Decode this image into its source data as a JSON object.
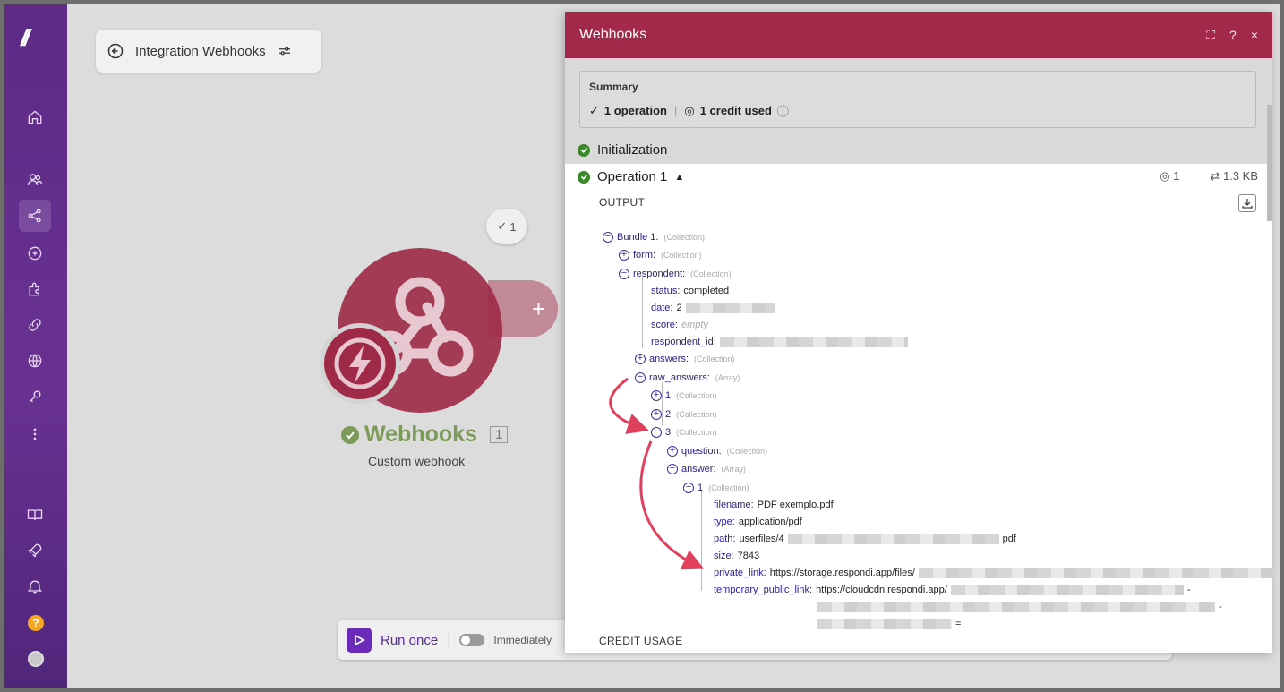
{
  "breadcrumb": {
    "title": "Integration Webhooks"
  },
  "module": {
    "name": "Webhooks",
    "index": "1",
    "subtitle": "Custom webhook",
    "ops_badge": "1"
  },
  "runbar": {
    "run_label": "Run once",
    "toggle_label": "Immediately"
  },
  "panel": {
    "title": "Webhooks",
    "controls": {
      "expand": "⛶",
      "help": "?",
      "close": "×"
    },
    "summary": {
      "label": "Summary",
      "operations": "1 operation",
      "credits": "1 credit used"
    },
    "initialization": "Initialization",
    "operation": {
      "label": "Operation 1",
      "ops": "1",
      "size": "1.3 KB"
    },
    "output_label": "OUTPUT",
    "credit_label": "CREDIT USAGE",
    "tree": {
      "bundle": "Bundle 1:",
      "bundle_type": "(Collection)",
      "form": "form:",
      "form_type": "(Collection)",
      "respondent": "respondent:",
      "respondent_type": "(Collection)",
      "status_k": "status:",
      "status_v": "completed",
      "date_k": "date:",
      "date_v": "2",
      "score_k": "score:",
      "score_v": "empty",
      "rid_k": "respondent_id:",
      "answers": "answers:",
      "answers_type": "(Collection)",
      "raw": "raw_answers:",
      "raw_type": "(Array)",
      "i1": "1",
      "i1_type": "(Collection)",
      "i2": "2",
      "i2_type": "(Collection)",
      "i3": "3",
      "i3_type": "(Collection)",
      "question": "question:",
      "question_type": "(Collection)",
      "answer": "answer:",
      "answer_type": "(Array)",
      "a1": "1",
      "a1_type": "(Collection)",
      "filename_k": "filename:",
      "filename_v": "PDF exemplo.pdf",
      "type_k": "type:",
      "type_v": "application/pdf",
      "path_k": "path:",
      "path_v": "userfiles/4",
      "path_end": "pdf",
      "size_k": "size:",
      "size_v": "7843",
      "private_k": "private_link:",
      "private_v": "https://storage.respondi.app/files/",
      "temp_k": "temporary_public_link:",
      "temp_v": "https://cloudcdn.respondi.app/",
      "temp_end1": "-",
      "temp_end2": "-",
      "temp_end3": "="
    }
  },
  "colors": {
    "accent": "#a3294a",
    "sidebar": "#5d2a86",
    "ok": "#3b8a2a",
    "arrow": "#e0405c"
  }
}
